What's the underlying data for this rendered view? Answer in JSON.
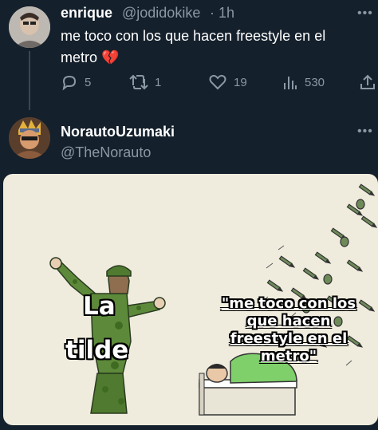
{
  "tweet": {
    "display_name": "enrique",
    "handle": "@jodidokike",
    "separator": "·",
    "time": "1h",
    "text": "me toco con los que hacen freestyle en el metro 💔",
    "replies": "5",
    "retweets": "1",
    "likes": "19",
    "views": "530"
  },
  "reply": {
    "display_name": "NorautoUzumaki",
    "handle": "@TheNorauto"
  },
  "meme": {
    "left_caption_line1": "La",
    "left_caption_line2": "tilde",
    "right_caption": "\"me toco con los que hacen freestyle en el metro\""
  },
  "colors": {
    "background": "#14202b",
    "text": "#ffffff",
    "secondary_text": "#8b98a5",
    "meme_background": "#efecde",
    "soldier_green": "#5d8a3a"
  },
  "icons": [
    "more-icon",
    "reply-icon",
    "retweet-icon",
    "like-icon",
    "views-icon",
    "share-icon",
    "broken-heart-icon"
  ]
}
